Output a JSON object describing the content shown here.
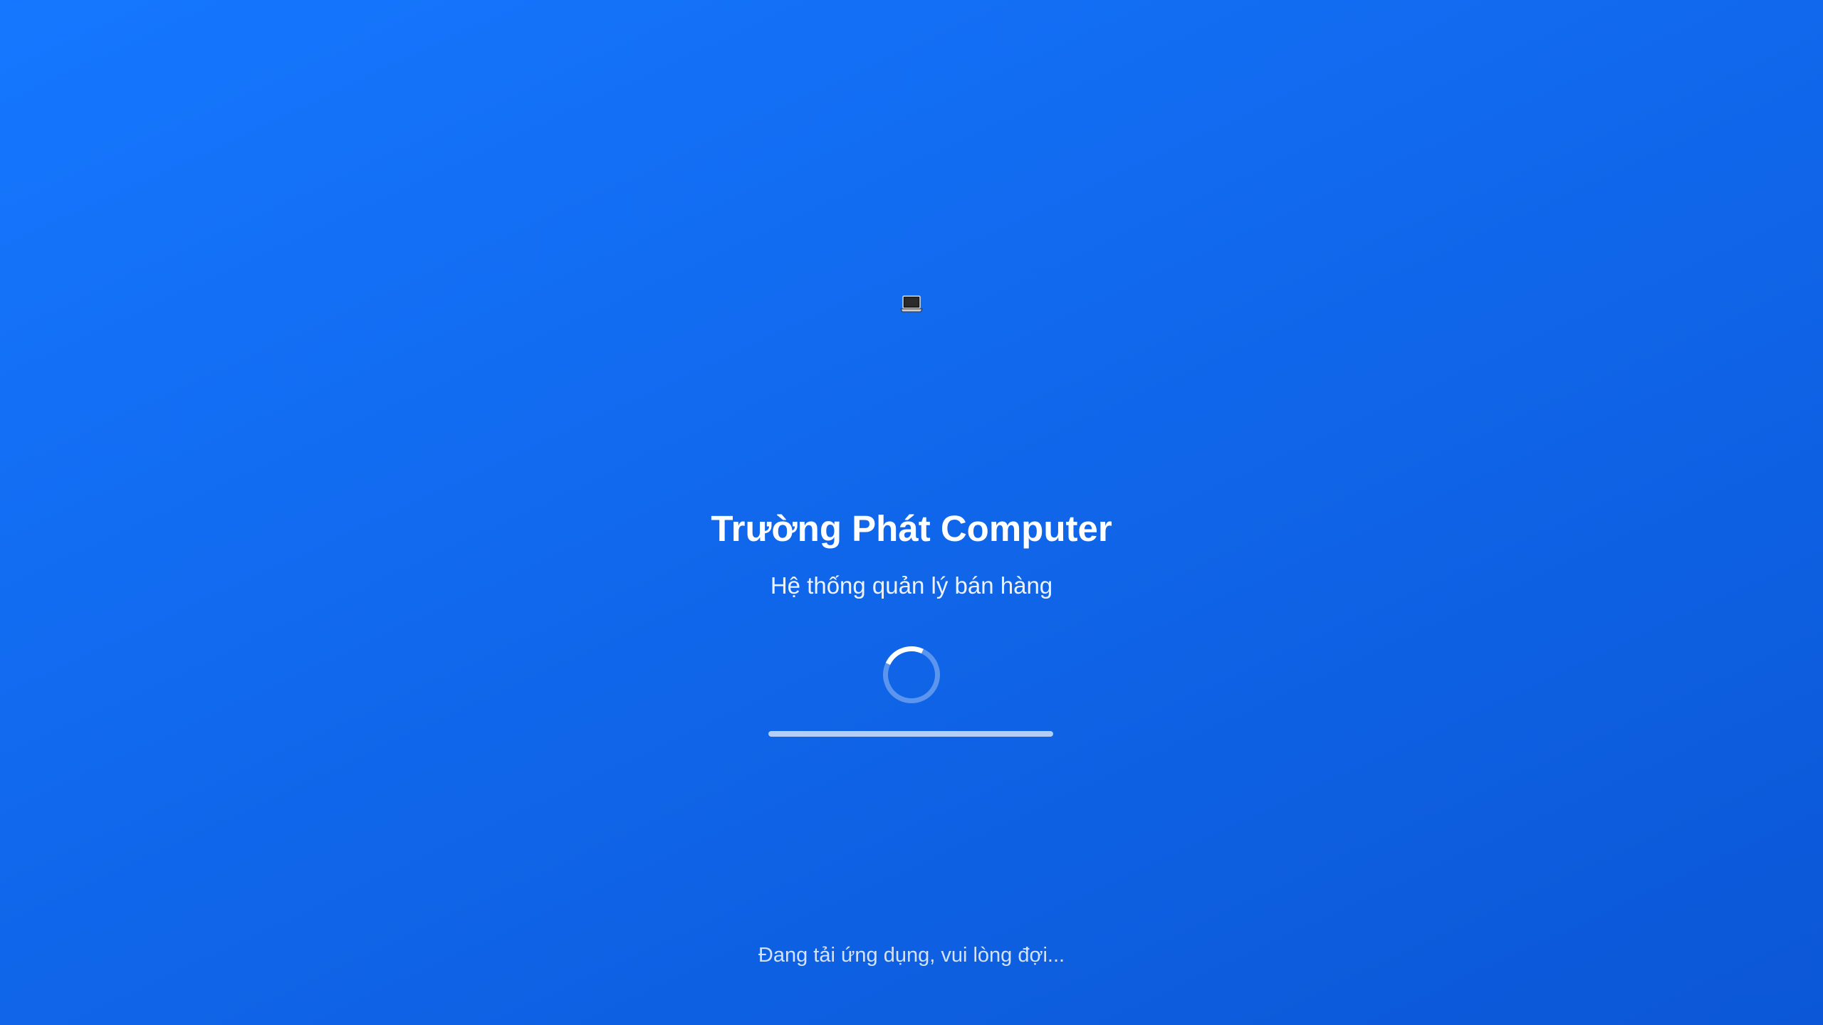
{
  "splash": {
    "logo_icon": "laptop-icon",
    "title": "Trường Phát Computer",
    "subtitle": "Hệ thống quản lý bán hàng",
    "spinner_icon": "loading-spinner",
    "progress_fraction": 1.0,
    "loading_message": "Đang tải ứng dụng, vui lòng đợi..."
  },
  "colors": {
    "background_start": "#1577ff",
    "background_end": "#0b57d7",
    "text": "#ffffff"
  }
}
